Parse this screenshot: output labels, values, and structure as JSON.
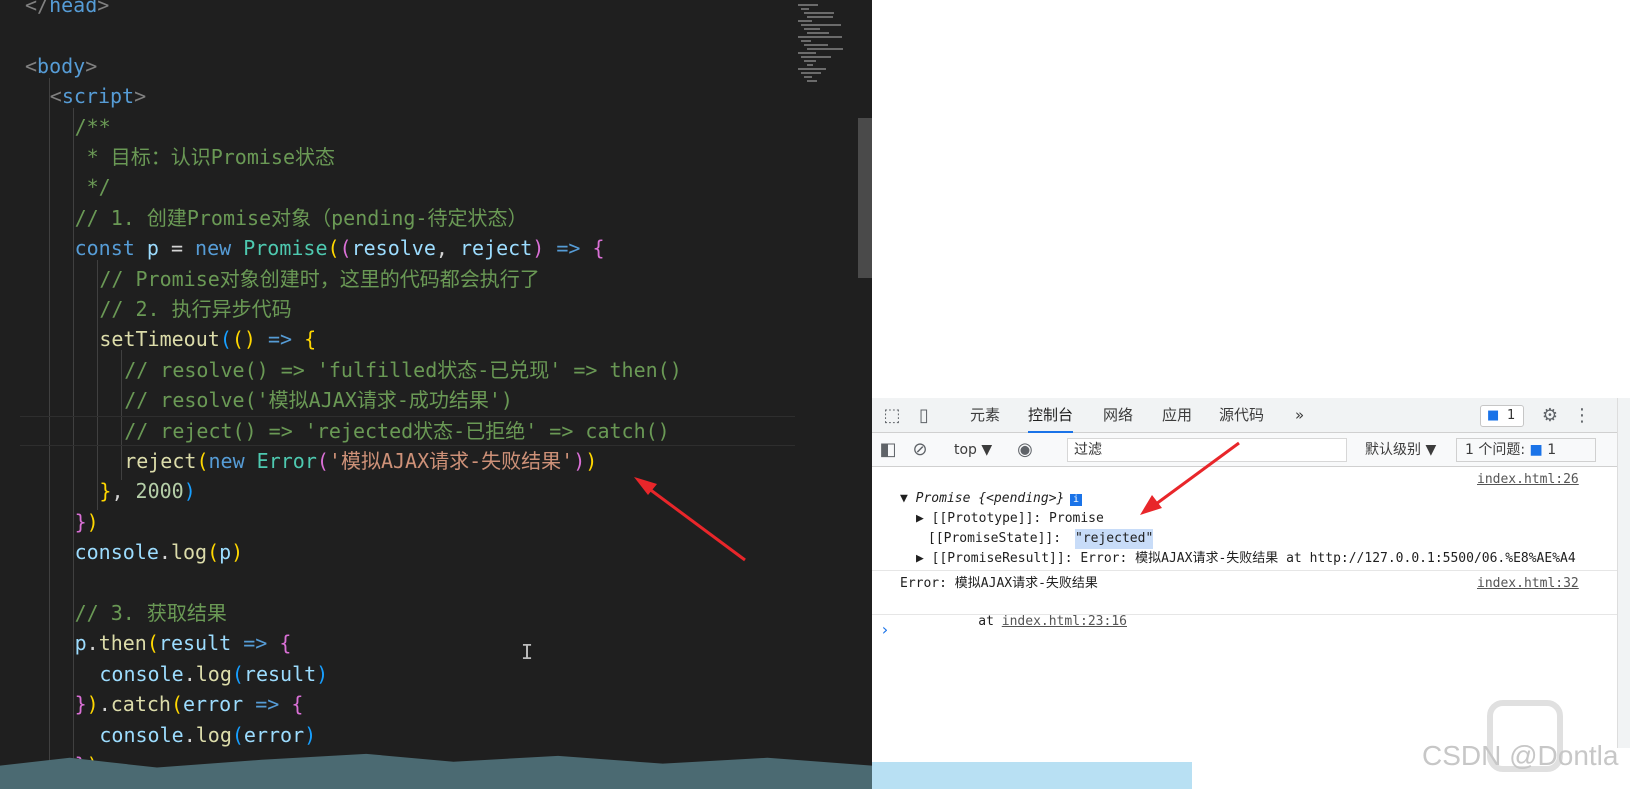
{
  "editor": {
    "lines": [
      {
        "indent": 1,
        "segs": [
          [
            "t-tag",
            "</"
          ],
          [
            "t-tn",
            "head"
          ],
          [
            "t-tag",
            ">"
          ]
        ]
      },
      {
        "indent": 0,
        "segs": []
      },
      {
        "indent": 1,
        "segs": [
          [
            "t-tag",
            "<"
          ],
          [
            "t-tn",
            "body"
          ],
          [
            "t-tag",
            ">"
          ]
        ]
      },
      {
        "indent": 2,
        "segs": [
          [
            "t-tag",
            "<"
          ],
          [
            "t-tn",
            "script"
          ],
          [
            "t-tag",
            ">"
          ]
        ]
      },
      {
        "indent": 3,
        "segs": [
          [
            "t-com",
            "/**"
          ]
        ]
      },
      {
        "indent": 3,
        "segs": [
          [
            "t-com",
            " * 目标：认识Promise状态"
          ]
        ]
      },
      {
        "indent": 3,
        "segs": [
          [
            "t-com",
            " */"
          ]
        ]
      },
      {
        "indent": 3,
        "segs": [
          [
            "t-com",
            "// 1. 创建Promise对象（pending-待定状态）"
          ]
        ]
      },
      {
        "indent": 3,
        "segs": [
          [
            "t-kw",
            "const"
          ],
          [
            "t-op",
            " "
          ],
          [
            "t-var",
            "p"
          ],
          [
            "t-op",
            " = "
          ],
          [
            "t-kw",
            "new"
          ],
          [
            "t-op",
            " "
          ],
          [
            "t-cls",
            "Promise"
          ],
          [
            "t-b1",
            "("
          ],
          [
            "t-b2",
            "("
          ],
          [
            "t-var",
            "resolve"
          ],
          [
            "t-op",
            ", "
          ],
          [
            "t-var",
            "reject"
          ],
          [
            "t-b2",
            ")"
          ],
          [
            "t-op",
            " "
          ],
          [
            "t-kw",
            "=>"
          ],
          [
            "t-op",
            " "
          ],
          [
            "t-b2",
            "{"
          ]
        ]
      },
      {
        "indent": 4,
        "segs": [
          [
            "t-com",
            "// Promise对象创建时，这里的代码都会执行了"
          ]
        ]
      },
      {
        "indent": 4,
        "segs": [
          [
            "t-com",
            "// 2. 执行异步代码"
          ]
        ]
      },
      {
        "indent": 4,
        "segs": [
          [
            "t-fn",
            "setTimeout"
          ],
          [
            "t-b3",
            "("
          ],
          [
            "t-b1",
            "("
          ],
          [
            "t-b1",
            ")"
          ],
          [
            "t-op",
            " "
          ],
          [
            "t-kw",
            "=>"
          ],
          [
            "t-op",
            " "
          ],
          [
            "t-b1",
            "{"
          ]
        ]
      },
      {
        "indent": 5,
        "segs": [
          [
            "t-com",
            "// resolve() => 'fulfilled状态-已兑现' => then()"
          ]
        ]
      },
      {
        "indent": 5,
        "segs": [
          [
            "t-com",
            "// resolve('模拟AJAX请求-成功结果')"
          ]
        ]
      },
      {
        "indent": 5,
        "segs": [
          [
            "t-com",
            "// reject() => 'rejected状态-已拒绝' => catch()"
          ]
        ]
      },
      {
        "indent": 5,
        "segs": [
          [
            "t-fn",
            "reject"
          ],
          [
            "t-b1",
            "("
          ],
          [
            "t-kw",
            "new"
          ],
          [
            "t-op",
            " "
          ],
          [
            "t-cls",
            "Error"
          ],
          [
            "t-b2",
            "("
          ],
          [
            "t-str",
            "'模拟AJAX请求-失败结果'"
          ],
          [
            "t-b2",
            ")"
          ],
          [
            "t-b1",
            ")"
          ]
        ]
      },
      {
        "indent": 4,
        "segs": [
          [
            "t-b1",
            "}"
          ],
          [
            "t-op",
            ", "
          ],
          [
            "t-num",
            "2000"
          ],
          [
            "t-b3",
            ")"
          ]
        ]
      },
      {
        "indent": 3,
        "segs": [
          [
            "t-b2",
            "}"
          ],
          [
            "t-b1",
            ")"
          ]
        ]
      },
      {
        "indent": 3,
        "segs": [
          [
            "t-var",
            "console"
          ],
          [
            "t-op",
            "."
          ],
          [
            "t-fn",
            "log"
          ],
          [
            "t-b1",
            "("
          ],
          [
            "t-var",
            "p"
          ],
          [
            "t-b1",
            ")"
          ]
        ]
      },
      {
        "indent": 0,
        "segs": []
      },
      {
        "indent": 3,
        "segs": [
          [
            "t-com",
            "// 3. 获取结果"
          ]
        ]
      },
      {
        "indent": 3,
        "segs": [
          [
            "t-var",
            "p"
          ],
          [
            "t-op",
            "."
          ],
          [
            "t-fn",
            "then"
          ],
          [
            "t-b1",
            "("
          ],
          [
            "t-var",
            "result"
          ],
          [
            "t-op",
            " "
          ],
          [
            "t-kw",
            "=>"
          ],
          [
            "t-op",
            " "
          ],
          [
            "t-b2",
            "{"
          ]
        ]
      },
      {
        "indent": 4,
        "segs": [
          [
            "t-var",
            "console"
          ],
          [
            "t-op",
            "."
          ],
          [
            "t-fn",
            "log"
          ],
          [
            "t-b3",
            "("
          ],
          [
            "t-var",
            "result"
          ],
          [
            "t-b3",
            ")"
          ]
        ]
      },
      {
        "indent": 3,
        "segs": [
          [
            "t-b2",
            "}"
          ],
          [
            "t-b1",
            ")"
          ],
          [
            "t-op",
            "."
          ],
          [
            "t-fn",
            "catch"
          ],
          [
            "t-b1",
            "("
          ],
          [
            "t-var",
            "error"
          ],
          [
            "t-op",
            " "
          ],
          [
            "t-kw",
            "=>"
          ],
          [
            "t-op",
            " "
          ],
          [
            "t-b2",
            "{"
          ]
        ]
      },
      {
        "indent": 4,
        "segs": [
          [
            "t-var",
            "console"
          ],
          [
            "t-op",
            "."
          ],
          [
            "t-fn",
            "log"
          ],
          [
            "t-b3",
            "("
          ],
          [
            "t-var",
            "error"
          ],
          [
            "t-b3",
            ")"
          ]
        ]
      },
      {
        "indent": 3,
        "segs": [
          [
            "t-b2",
            "}"
          ],
          [
            "t-b1",
            ")"
          ]
        ]
      }
    ]
  },
  "devtools": {
    "tabs": [
      "元素",
      "控制台",
      "网络",
      "应用",
      "源代码"
    ],
    "active_tab": "控制台",
    "more_tabs": "»",
    "issues_count": "1",
    "context": "top ▼",
    "filter_placeholder": "过滤",
    "level": "默认级别 ▼",
    "issues_label": "1 个问题:",
    "issues_label_count": "1"
  },
  "console": {
    "entry1_source": "index.html:26",
    "promise_header": "▼ Promise {<pending>}",
    "prototype_row": "▶ [[Prototype]]: Promise",
    "state_key": "[[PromiseState]]: ",
    "state_value": "\"rejected\"",
    "result_row": "▶ [[PromiseResult]]: Error: 模拟AJAX请求-失败结果 at http://127.0.0.1:5500/06.%E8%AE%A4",
    "entry2_source": "index.html:32",
    "error_line": "Error: 模拟AJAX请求-失败结果",
    "at_prefix": "    at ",
    "at_link": "index.html:23:16",
    "prompt": "›"
  },
  "watermark": "CSDN @Dontla",
  "colors": {
    "editor_bg": "#1f1f1f",
    "accent_blue": "#1a73e8",
    "arrow_red": "#e8262a"
  }
}
